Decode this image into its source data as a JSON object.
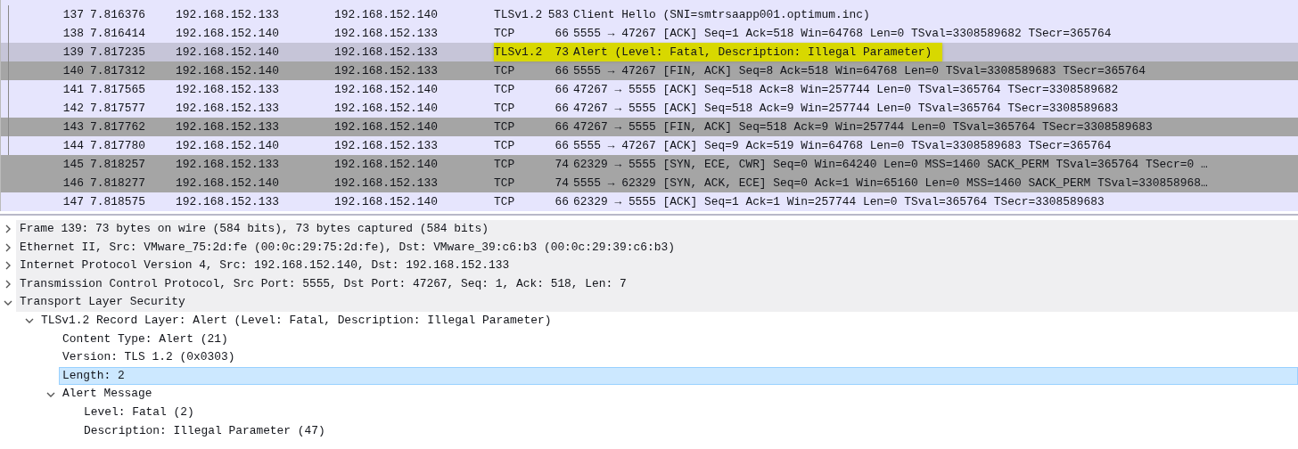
{
  "packets": [
    {
      "no": "137",
      "time": "7.816376",
      "source": "192.168.152.133",
      "destination": "192.168.152.140",
      "protocol": "TLSv1.2",
      "length": "583",
      "info": "Client Hello (SNI=smtrsaapp001.optimum.inc)",
      "kind": "normal",
      "selected": false,
      "highlighted": false,
      "related": true
    },
    {
      "no": "138",
      "time": "7.816414",
      "source": "192.168.152.140",
      "destination": "192.168.152.133",
      "protocol": "TCP",
      "length": "66",
      "info": "5555 → 47267 [ACK] Seq=1 Ack=518 Win=64768 Len=0 TSval=3308589682 TSecr=365764",
      "kind": "normal",
      "selected": false,
      "highlighted": false,
      "related": true
    },
    {
      "no": "139",
      "time": "7.817235",
      "source": "192.168.152.140",
      "destination": "192.168.152.133",
      "protocol": "TLSv1.2",
      "length": "73",
      "info": "Alert (Level: Fatal, Description: Illegal Parameter)",
      "kind": "normal",
      "selected": true,
      "highlighted": true,
      "related": true
    },
    {
      "no": "140",
      "time": "7.817312",
      "source": "192.168.152.140",
      "destination": "192.168.152.133",
      "protocol": "TCP",
      "length": "66",
      "info": "5555 → 47267 [FIN, ACK] Seq=8 Ack=518 Win=64768 Len=0 TSval=3308589683 TSecr=365764",
      "kind": "flags",
      "selected": false,
      "highlighted": false,
      "related": true
    },
    {
      "no": "141",
      "time": "7.817565",
      "source": "192.168.152.133",
      "destination": "192.168.152.140",
      "protocol": "TCP",
      "length": "66",
      "info": "47267 → 5555 [ACK] Seq=518 Ack=8 Win=257744 Len=0 TSval=365764 TSecr=3308589682",
      "kind": "normal",
      "selected": false,
      "highlighted": false,
      "related": true
    },
    {
      "no": "142",
      "time": "7.817577",
      "source": "192.168.152.133",
      "destination": "192.168.152.140",
      "protocol": "TCP",
      "length": "66",
      "info": "47267 → 5555 [ACK] Seq=518 Ack=9 Win=257744 Len=0 TSval=365764 TSecr=3308589683",
      "kind": "normal",
      "selected": false,
      "highlighted": false,
      "related": true
    },
    {
      "no": "143",
      "time": "7.817762",
      "source": "192.168.152.133",
      "destination": "192.168.152.140",
      "protocol": "TCP",
      "length": "66",
      "info": "47267 → 5555 [FIN, ACK] Seq=518 Ack=9 Win=257744 Len=0 TSval=365764 TSecr=3308589683",
      "kind": "flags",
      "selected": false,
      "highlighted": false,
      "related": true
    },
    {
      "no": "144",
      "time": "7.817780",
      "source": "192.168.152.140",
      "destination": "192.168.152.133",
      "protocol": "TCP",
      "length": "66",
      "info": "5555 → 47267 [ACK] Seq=9 Ack=519 Win=64768 Len=0 TSval=3308589683 TSecr=365764",
      "kind": "normal",
      "selected": false,
      "highlighted": false,
      "related": true
    },
    {
      "no": "145",
      "time": "7.818257",
      "source": "192.168.152.133",
      "destination": "192.168.152.140",
      "protocol": "TCP",
      "length": "74",
      "info": "62329 → 5555 [SYN, ECE, CWR] Seq=0 Win=64240 Len=0 MSS=1460 SACK_PERM TSval=365764 TSecr=0 …",
      "kind": "flags",
      "selected": false,
      "highlighted": false,
      "related": false
    },
    {
      "no": "146",
      "time": "7.818277",
      "source": "192.168.152.140",
      "destination": "192.168.152.133",
      "protocol": "TCP",
      "length": "74",
      "info": "5555 → 62329 [SYN, ACK, ECE] Seq=0 Ack=1 Win=65160 Len=0 MSS=1460 SACK_PERM TSval=330858968…",
      "kind": "flags",
      "selected": false,
      "highlighted": false,
      "related": false
    },
    {
      "no": "147",
      "time": "7.818575",
      "source": "192.168.152.133",
      "destination": "192.168.152.140",
      "protocol": "TCP",
      "length": "66",
      "info": "62329 → 5555 [ACK] Seq=1 Ack=1 Win=257744 Len=0 TSval=365764 TSecr=3308589683",
      "kind": "normal",
      "selected": false,
      "highlighted": false,
      "related": false
    }
  ],
  "details": [
    {
      "label": "Frame 139: 73 bytes on wire (584 bits), 73 bytes captured (584 bits)",
      "kind": "branch",
      "expanded": false,
      "selected": false
    },
    {
      "label": "Ethernet II, Src: VMware_75:2d:fe (00:0c:29:75:2d:fe), Dst: VMware_39:c6:b3 (00:0c:29:39:c6:b3)",
      "kind": "branch",
      "expanded": false,
      "selected": false
    },
    {
      "label": "Internet Protocol Version 4, Src: 192.168.152.140, Dst: 192.168.152.133",
      "kind": "branch",
      "expanded": false,
      "selected": false
    },
    {
      "label": "Transmission Control Protocol, Src Port: 5555, Dst Port: 47267, Seq: 1, Ack: 518, Len: 7",
      "kind": "branch",
      "expanded": false,
      "selected": false
    },
    {
      "label": "Transport Layer Security",
      "kind": "branch",
      "expanded": true,
      "selected": false,
      "children": [
        {
          "label": "TLSv1.2 Record Layer: Alert (Level: Fatal, Description: Illegal Parameter)",
          "kind": "branch",
          "expanded": true,
          "selected": false,
          "children": [
            {
              "label": "Content Type: Alert (21)",
              "kind": "leaf",
              "selected": false
            },
            {
              "label": "Version: TLS 1.2 (0x0303)",
              "kind": "leaf",
              "selected": false
            },
            {
              "label": "Length: 2",
              "kind": "leaf",
              "selected": true
            },
            {
              "label": "Alert Message",
              "kind": "branch",
              "expanded": true,
              "selected": false,
              "children": [
                {
                  "label": "Level: Fatal (2)",
                  "kind": "leaf",
                  "selected": false
                },
                {
                  "label": "Description: Illegal Parameter (47)",
                  "kind": "leaf",
                  "selected": false
                }
              ]
            }
          ]
        }
      ]
    }
  ]
}
